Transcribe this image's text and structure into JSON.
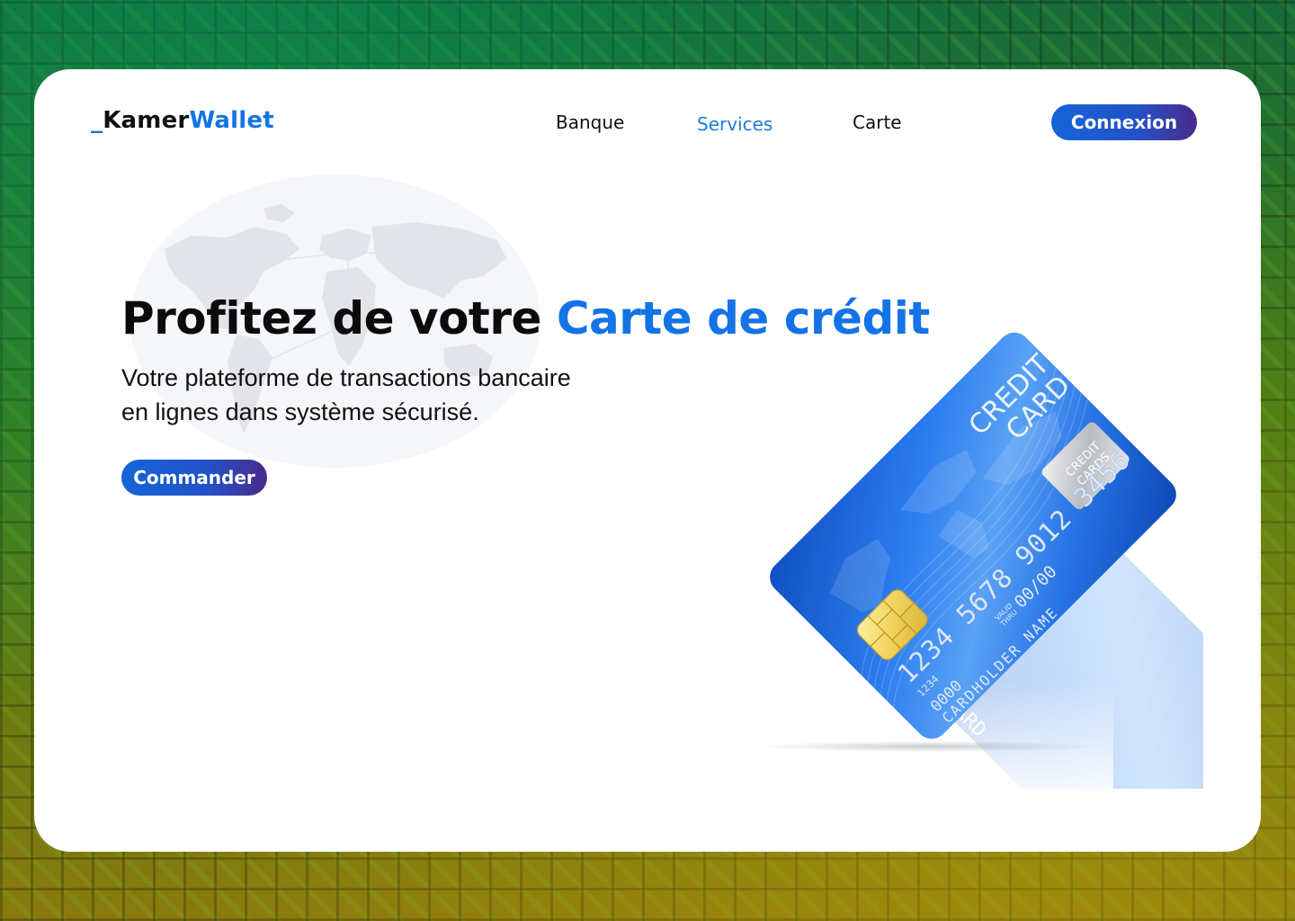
{
  "brand": {
    "prefix": "_",
    "part1": "Kamer",
    "part2": "Wallet"
  },
  "nav": {
    "items": [
      {
        "label": "Banque",
        "active": false
      },
      {
        "label": "Services",
        "active": true
      },
      {
        "label": "Carte",
        "active": false
      }
    ],
    "login_label": "Connexion"
  },
  "hero": {
    "headline_plain": "Profitez de votre",
    "headline_accent": "Carte de crédit",
    "subtitle_line1": "Votre plateforme de transactions bancaire",
    "subtitle_line2": "en lignes dans système sécurisé.",
    "cta_label": "Commander"
  },
  "credit_card": {
    "title_line1": "CREDIT",
    "title_line2": "CARD",
    "number": "1234 5678 9012 3456",
    "number_small": "1234",
    "code": "0000",
    "valid_label_1": "VALID",
    "valid_label_2": "THRU",
    "expiry": "00/00",
    "holder": "CARDHOLDER NAME",
    "hologram_line1": "CREDIT",
    "hologram_line2": "CARDS",
    "reflection_text": "CARD"
  },
  "colors": {
    "accent": "#1473e6",
    "button_start": "#1565d8",
    "button_end": "#4a2a8a",
    "card_blue": "#1f6fe0"
  }
}
